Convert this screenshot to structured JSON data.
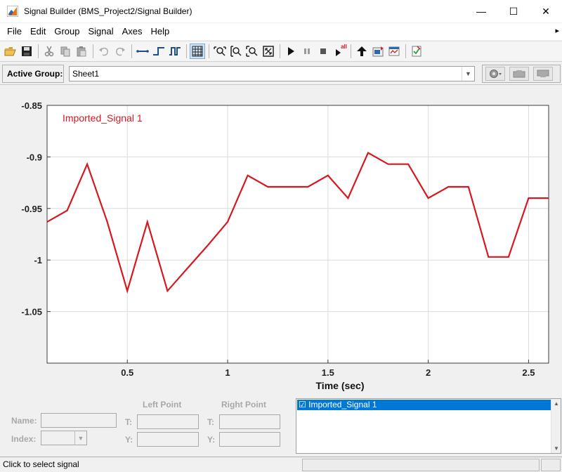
{
  "window": {
    "title": "Signal Builder (BMS_Project2/Signal Builder)",
    "controls": [
      "—",
      "☐",
      "✕"
    ]
  },
  "menu": {
    "items": [
      "File",
      "Edit",
      "Group",
      "Signal",
      "Axes",
      "Help"
    ],
    "overflow": "▸"
  },
  "toolbar": {
    "icons": [
      "open-icon",
      "save-icon",
      "cut-icon",
      "copy-icon",
      "paste-icon",
      "undo-icon",
      "redo-icon",
      "step-signal-icon",
      "pulse-signal-icon",
      "square-signal-icon",
      "grid-icon",
      "zoom-x-icon",
      "zoom-y-icon",
      "zoom-xy-icon",
      "zoom-fit-icon",
      "run-icon",
      "pause-icon",
      "stop-icon",
      "run-all-icon",
      "move-up-icon",
      "export-icon",
      "workspace-icon",
      "verify-icon"
    ],
    "run_all_badge": "all"
  },
  "group": {
    "label": "Active Group:",
    "value": "Sheet1"
  },
  "colors": {
    "signal": "#d41920",
    "grid": "#dcdcdc",
    "selection": "#0078d7"
  },
  "chart_data": {
    "type": "line",
    "xlabel": "Time (sec)",
    "ylabel": "",
    "xlim": [
      0.1,
      2.6
    ],
    "ylim": [
      -1.1,
      -0.85
    ],
    "x_ticks": [
      0.5,
      1,
      1.5,
      2,
      2.5
    ],
    "x_tick_labels": [
      "0.5",
      "1",
      "1.5",
      "2",
      "2.5"
    ],
    "y_ticks": [
      -0.85,
      -0.9,
      -0.95,
      -1,
      -1.05
    ],
    "y_tick_labels": [
      "-0.85",
      "-0.9",
      "-0.95",
      "-1",
      "-1.05"
    ],
    "grid": true,
    "legend": "top-left",
    "series": [
      {
        "name": "Imported_Signal 1",
        "x": [
          0.1,
          0.2,
          0.3,
          0.4,
          0.5,
          0.6,
          0.7,
          0.8,
          0.9,
          1.0,
          1.1,
          1.2,
          1.3,
          1.4,
          1.5,
          1.6,
          1.7,
          1.8,
          1.9,
          2.0,
          2.1,
          2.2,
          2.3,
          2.4,
          2.5,
          2.6
        ],
        "y": [
          -0.963,
          -0.952,
          -0.907,
          -0.963,
          -1.03,
          -0.963,
          -1.03,
          -1.008,
          -0.986,
          -0.963,
          -0.918,
          -0.929,
          -0.929,
          -0.929,
          -0.918,
          -0.94,
          -0.896,
          -0.907,
          -0.907,
          -0.94,
          -0.929,
          -0.929,
          -0.997,
          -0.997,
          -0.94,
          -0.94
        ]
      }
    ]
  },
  "fields": {
    "name_label": "Name:",
    "index_label": "Index:",
    "left_point": "Left Point",
    "right_point": "Right Point",
    "t_label": "T:",
    "y_label": "Y:"
  },
  "signal_list": {
    "items": [
      {
        "label": "Imported_Signal 1",
        "checked": true,
        "checkbox": "☑"
      }
    ]
  },
  "status": {
    "text": "Click to select signal"
  }
}
